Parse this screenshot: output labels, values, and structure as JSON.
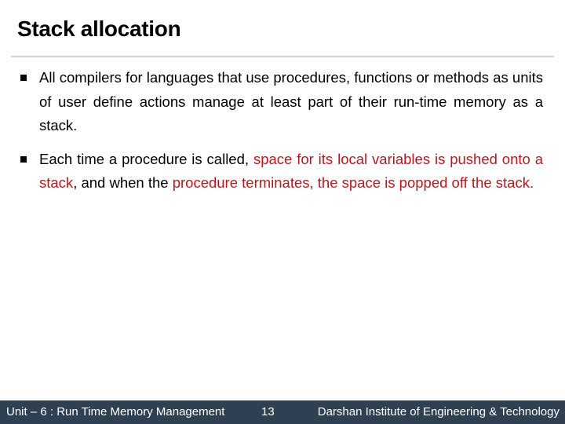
{
  "slide": {
    "title": "Stack allocation",
    "bullets": [
      {
        "segments": [
          {
            "text": "All compilers for languages that use procedures, functions or methods as units of user define actions manage at least part of their run-time memory as a stack.",
            "highlight": false
          }
        ]
      },
      {
        "segments": [
          {
            "text": "Each time a procedure is called, ",
            "highlight": false
          },
          {
            "text": "space for its local variables is pushed onto a stack",
            "highlight": true
          },
          {
            "text": ", and when the ",
            "highlight": false
          },
          {
            "text": "procedure terminates, the space is popped off the stack.",
            "highlight": true
          }
        ]
      }
    ]
  },
  "footer": {
    "unit": "Unit – 6 : Run Time Memory Management",
    "page": "13",
    "institute": "Darshan Institute of Engineering & Technology"
  },
  "colors": {
    "highlight": "#c0141c",
    "footer_bg": "#2e4052",
    "rule": "#d6d6d6"
  }
}
